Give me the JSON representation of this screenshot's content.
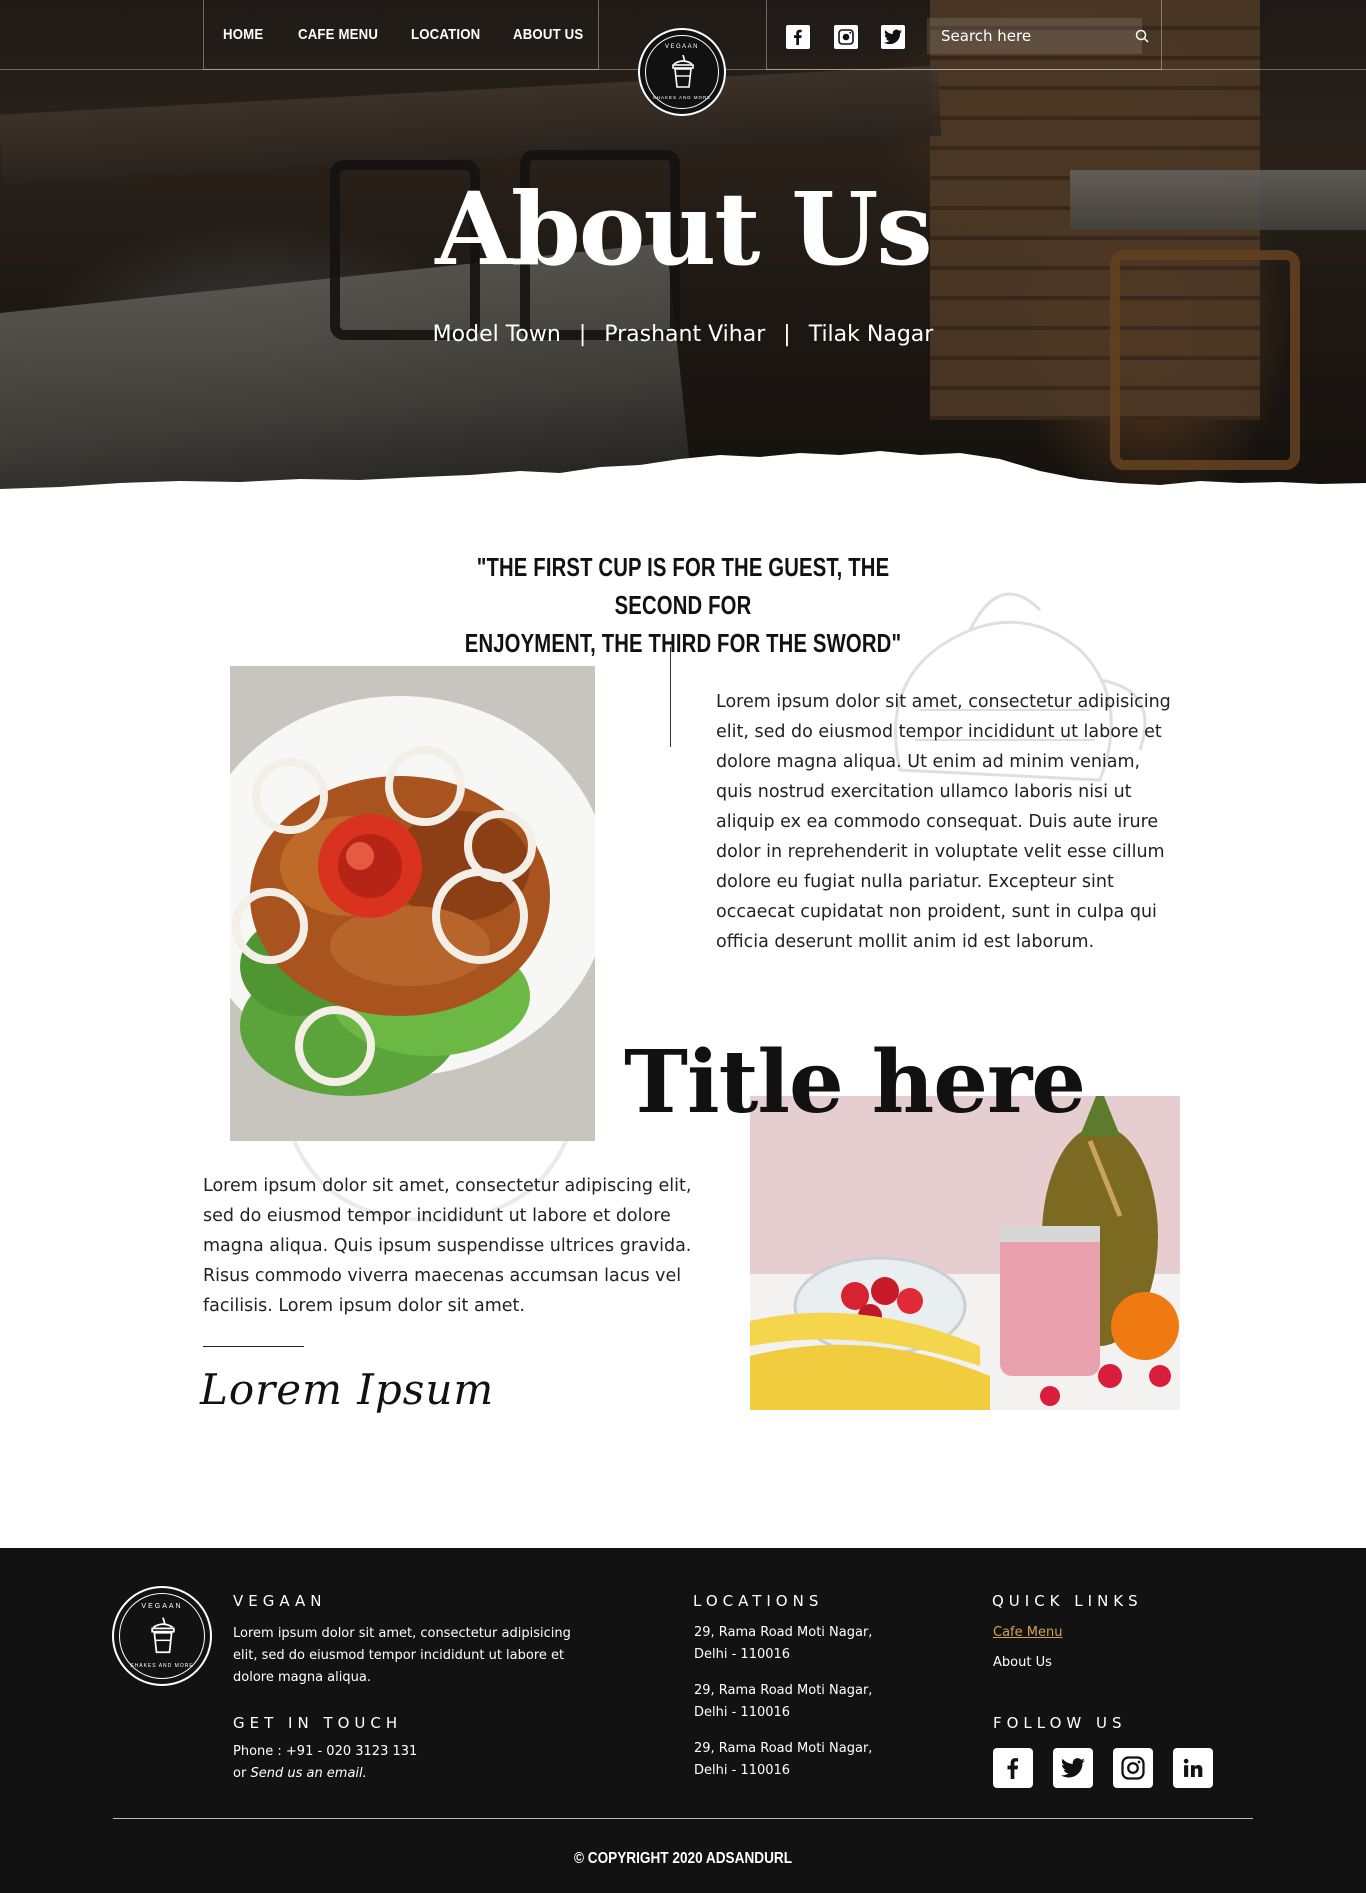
{
  "nav": {
    "links": [
      "HOME",
      "CAFE MENU",
      "LOCATION",
      "ABOUT US"
    ],
    "logo": {
      "name": "VEGAAN",
      "tagline": "SHAKES AND MORE"
    },
    "social_icons": [
      "facebook-icon",
      "instagram-icon",
      "twitter-icon"
    ],
    "search": {
      "placeholder": "Search here",
      "value": ""
    }
  },
  "hero": {
    "title": "About Us",
    "locations": [
      "Model Town",
      "Prashant Vihar",
      "Tilak Nagar"
    ],
    "separator": "|"
  },
  "content": {
    "quote_line1": "\"THE FIRST CUP IS FOR THE GUEST, THE SECOND FOR",
    "quote_line2": "ENJOYMENT, THE THIRD FOR THE SWORD\"",
    "paragraph1": "Lorem ipsum dolor sit amet, consectetur adipisicing elit, sed do eiusmod tempor incididunt ut labore et dolore magna aliqua. Ut enim ad minim veniam, quis nostrud exercitation ullamco laboris nisi ut aliquip ex ea commodo consequat. Duis aute irure dolor in reprehenderit in voluptate velit esse cillum dolore eu fugiat nulla pariatur. Excepteur sint occaecat cupidatat non proident, sunt in culpa qui officia deserunt mollit anim id est laborum.",
    "title": "Title here",
    "paragraph2": "Lorem ipsum dolor sit amet, consectetur adipiscing elit, sed do eiusmod tempor incididunt ut labore et dolore magna aliqua. Quis ipsum suspendisse ultrices gravida. Risus commodo viverra maecenas accumsan lacus vel facilisis. Lorem ipsum dolor sit amet.",
    "signature": "Lorem Ipsum"
  },
  "footer": {
    "brand": {
      "heading": "VEGAAN",
      "text": "Lorem ipsum dolor sit amet, consectetur adipisicing elit, sed do eiusmod tempor incididunt ut labore et dolore magna aliqua."
    },
    "contact": {
      "heading": "GET IN TOUCH",
      "phone": "Phone : +91 - 020 3123 131",
      "email_prefix": "or",
      "email_link": "Send us an email."
    },
    "locations": {
      "heading": "LOCATIONS",
      "items": [
        {
          "line1": "29, Rama Road Moti Nagar,",
          "line2": "Delhi - 110016"
        },
        {
          "line1": "29, Rama Road Moti Nagar,",
          "line2": "Delhi - 110016"
        },
        {
          "line1": "29, Rama Road Moti Nagar,",
          "line2": "Delhi - 110016"
        }
      ]
    },
    "quick_links": {
      "heading": "QUICK LINKS",
      "items": [
        "Cafe Menu",
        "About Us"
      ]
    },
    "follow": {
      "heading": "FOLLOW US",
      "icons": [
        "facebook-icon",
        "twitter-icon",
        "instagram-icon",
        "linkedin-icon"
      ]
    },
    "copyright": "© COPYRIGHT 2020 ADSANDURL"
  },
  "colors": {
    "footer_bg": "#121212",
    "accent_link": "#d4a054",
    "text": "#1a1a1a"
  }
}
